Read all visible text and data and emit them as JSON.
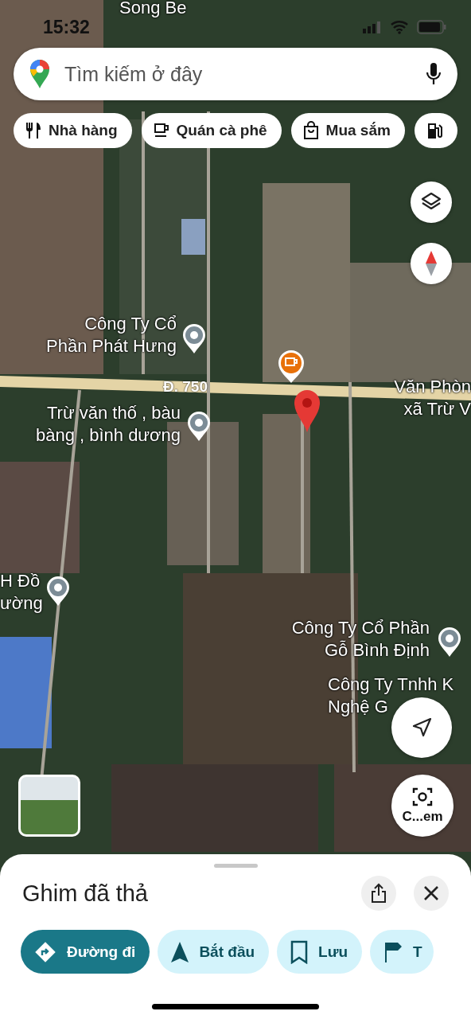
{
  "status_bar": {
    "time": "15:32"
  },
  "search": {
    "placeholder": "Tìm kiếm ở đây"
  },
  "categories": [
    {
      "label": "Nhà hàng",
      "kind": "restaurant"
    },
    {
      "label": "Quán cà phê",
      "kind": "cafe"
    },
    {
      "label": "Mua sắm",
      "kind": "shopping"
    },
    {
      "kind": "gas"
    }
  ],
  "map_labels": [
    {
      "lines": [
        "Song Be"
      ],
      "kind": "area"
    },
    {
      "lines": [
        "Công Ty Cổ",
        "Phần Phát Hưng"
      ],
      "kind": "poi"
    },
    {
      "lines": [
        "Đ. 750"
      ],
      "kind": "road"
    },
    {
      "lines": [
        "Trừ văn thố , bàu",
        "bàng , bình dương"
      ],
      "kind": "poi"
    },
    {
      "lines": [
        "Văn Phòn",
        "xã Trừ V"
      ],
      "kind": "area"
    },
    {
      "lines": [
        "H Đồ",
        "ường"
      ],
      "kind": "poi"
    },
    {
      "lines": [
        "Công Ty Cổ Phần",
        "Gỗ Bình Định"
      ],
      "kind": "poi"
    },
    {
      "lines": [
        "Công Ty Tnhh K",
        "Nghệ G"
      ],
      "kind": "area"
    }
  ],
  "camera_button": {
    "label": "C...em"
  },
  "place_sheet": {
    "title": "Ghim đã thả",
    "actions": [
      {
        "label": "Đường đi",
        "kind": "directions",
        "selected": true
      },
      {
        "label": "Bắt đầu",
        "kind": "start",
        "selected": false
      },
      {
        "label": "Lưu",
        "kind": "save",
        "selected": false
      },
      {
        "label": "T",
        "kind": "flag",
        "selected": false
      }
    ]
  }
}
